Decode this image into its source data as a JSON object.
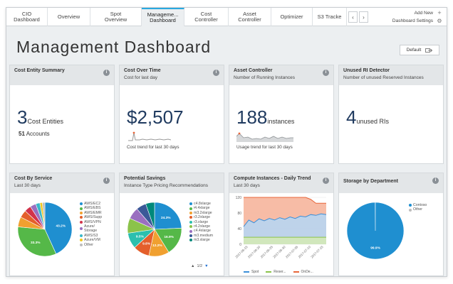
{
  "tabs": [
    {
      "label": "CIO\nDashboard"
    },
    {
      "label": "Overview"
    },
    {
      "label": "Spot\nOverview"
    },
    {
      "label": "Manageme...\nDashboard"
    },
    {
      "label": "Cost\nController"
    },
    {
      "label": "Asset\nController"
    },
    {
      "label": "Optimizer"
    },
    {
      "label": "S3 Tracke"
    }
  ],
  "tab_actions": {
    "add_new": "Add New",
    "settings": "Dashboard Settings"
  },
  "page_title": "Management Dashboard",
  "default_button": "Default",
  "cards": {
    "cost_entity": {
      "title": "Cost Entity Summary",
      "number": "3",
      "unit": "Cost Entities",
      "accounts_num": "51",
      "accounts_label": "Accounts"
    },
    "cost_time": {
      "title": "Cost Over Time",
      "subtitle": "Cost for last day",
      "value": "$2,507",
      "caption": "Cost trend for last 30 days"
    },
    "asset": {
      "title": "Asset Controller",
      "subtitle": "Number of Running Instances",
      "value": "188",
      "unit": "instances",
      "caption": "Usage trend for last 30 days"
    },
    "unused_ri": {
      "title": "Unused RI Detector",
      "subtitle": "Number of unused Reserved Instances",
      "value": "4",
      "unit": "unused RIs"
    },
    "cost_service": {
      "title": "Cost By Service",
      "subtitle": "Last 30 days",
      "legend": [
        "AWS/EC2",
        "AWS/EBS",
        "AWS/EMR",
        "AWS/Supp",
        "AWS/VPN",
        "Azure/\nStorage",
        "AWS/S3",
        "Azure/VM",
        "Other"
      ],
      "colors": [
        "#1f8fd0",
        "#55b848",
        "#f0a030",
        "#e45f2b",
        "#d2324a",
        "#9a6fc0",
        "#3ab8c8",
        "#f2c81c",
        "#bdbdbd"
      ],
      "values": [
        43.2,
        33.3,
        6.0,
        4.5,
        4.0,
        3.5,
        2.5,
        1.5,
        1.5
      ],
      "labels": [
        "43.2%",
        "33.3%"
      ]
    },
    "potential_savings": {
      "title": "Potential Savings",
      "subtitle": "Instance Type Pricing Recommendations",
      "legend": [
        "c4.8xlarge",
        "i4.4xlarge",
        "m3.2xlarge",
        "r3.2xlarge",
        "r3.xlarge",
        "r4.2xlarge",
        "c4.4xlarge",
        "m3.medium",
        "m3.xlarge"
      ],
      "colors": [
        "#1f8fd0",
        "#55b848",
        "#f0a030",
        "#e45f2b",
        "#2cbfae",
        "#8bc34a",
        "#9a6fc0",
        "#3b5998",
        "#00897b"
      ],
      "values": [
        24.3,
        16.9,
        12.2,
        9.8,
        9.5,
        9.0,
        7.0,
        6.0,
        5.3
      ],
      "labels": [
        "24.3%",
        "16.9%",
        "12.2%",
        "9.8%",
        "9.5%"
      ],
      "pager": "1/2"
    },
    "compute": {
      "title": "Compute Instances - Daily Trend",
      "subtitle": "Last 30 days",
      "y_ticks": [
        "120",
        "80",
        "40",
        "0"
      ],
      "x_ticks": [
        "2017-06-15",
        "2017-06-20",
        "2017-06-25",
        "2017-06-30",
        "2017-07-05",
        "2017-07-10",
        "2017-07-15"
      ],
      "legend": [
        "Spot",
        "Reser...",
        "OnDe..."
      ],
      "colors": [
        "#3b8fd8",
        "#8bc34a",
        "#e8663a"
      ]
    },
    "storage": {
      "title": "Storage by Department",
      "legend": [
        "Contoso",
        "Other"
      ],
      "colors": [
        "#1f8fd0",
        "#bdbdbd"
      ],
      "values": [
        99.9,
        0.1
      ],
      "label": "99.9%"
    }
  },
  "chart_data": [
    {
      "type": "pie",
      "title": "Cost By Service",
      "categories": [
        "AWS/EC2",
        "AWS/EBS",
        "AWS/EMR",
        "AWS/Supp",
        "AWS/VPN",
        "Azure/Storage",
        "AWS/S3",
        "Azure/VM",
        "Other"
      ],
      "values": [
        43.2,
        33.3,
        6.0,
        4.5,
        4.0,
        3.5,
        2.5,
        1.5,
        1.5
      ]
    },
    {
      "type": "pie",
      "title": "Potential Savings",
      "categories": [
        "c4.8xlarge",
        "i4.4xlarge",
        "m3.2xlarge",
        "r3.2xlarge",
        "r3.xlarge",
        "r4.2xlarge",
        "c4.4xlarge",
        "m3.medium",
        "m3.xlarge"
      ],
      "values": [
        24.3,
        16.9,
        12.2,
        9.8,
        9.5,
        9.0,
        7.0,
        6.0,
        5.3
      ]
    },
    {
      "type": "area",
      "title": "Compute Instances - Daily Trend",
      "ylim": [
        0,
        120
      ],
      "x": [
        "2017-06-13",
        "2017-06-15",
        "2017-06-17",
        "2017-06-19",
        "2017-06-21",
        "2017-06-23",
        "2017-06-25",
        "2017-06-27",
        "2017-06-29",
        "2017-07-01",
        "2017-07-03",
        "2017-07-05",
        "2017-07-07",
        "2017-07-09",
        "2017-07-11",
        "2017-07-13",
        "2017-07-15"
      ],
      "series": [
        {
          "name": "Spot",
          "values": [
            45,
            62,
            55,
            65,
            60,
            66,
            62,
            68,
            64,
            70,
            66,
            72,
            70,
            76,
            74,
            78,
            76
          ]
        },
        {
          "name": "Reser...",
          "values": [
            18,
            18,
            18,
            18,
            18,
            18,
            18,
            18,
            18,
            18,
            18,
            18,
            18,
            18,
            18,
            18,
            18
          ]
        },
        {
          "name": "OnDe...",
          "values": [
            120,
            120,
            120,
            120,
            120,
            120,
            120,
            120,
            120,
            120,
            120,
            120,
            120,
            115,
            105,
            105,
            105
          ]
        }
      ]
    },
    {
      "type": "pie",
      "title": "Storage by Department",
      "categories": [
        "Contoso",
        "Other"
      ],
      "values": [
        99.9,
        0.1
      ]
    }
  ]
}
